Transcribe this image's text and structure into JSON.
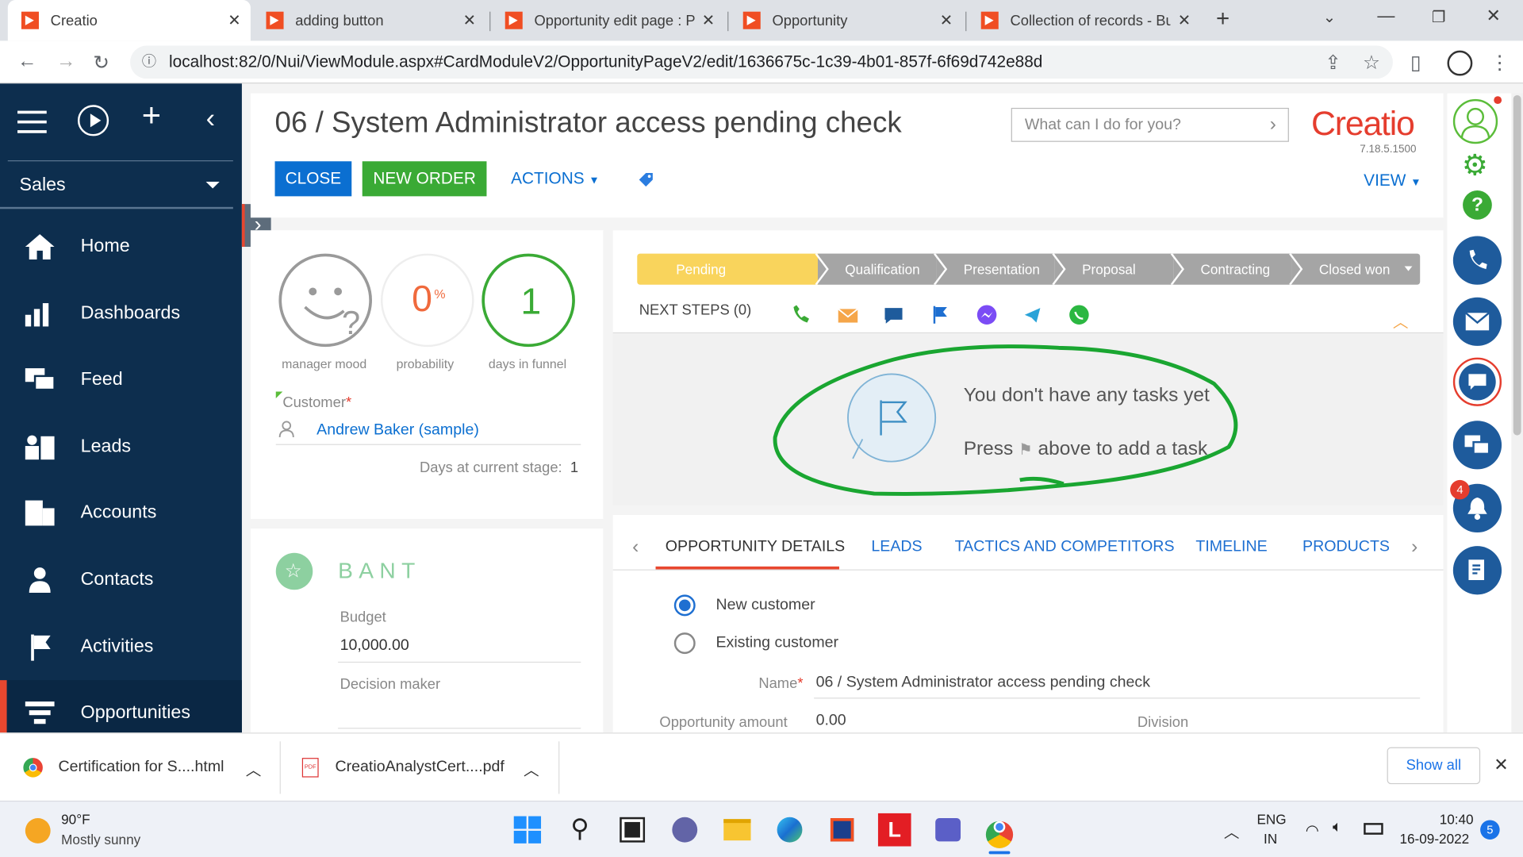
{
  "browser": {
    "tabs": [
      {
        "title": "Creatio",
        "active": true
      },
      {
        "title": "adding button"
      },
      {
        "title": "Opportunity edit page : P"
      },
      {
        "title": "Opportunity"
      },
      {
        "title": "Collection of records - Bu"
      }
    ],
    "url": "localhost:82/0/Nui/ViewModule.aspx#CardModuleV2/OpportunityPageV2/edit/1636675c-1c39-4b01-857f-6f69d742e88d"
  },
  "sidebar": {
    "workplace": "Sales",
    "items": [
      {
        "label": "Home",
        "icon": "home-icon"
      },
      {
        "label": "Dashboards",
        "icon": "dashboards-icon"
      },
      {
        "label": "Feed",
        "icon": "feed-icon"
      },
      {
        "label": "Leads",
        "icon": "leads-icon"
      },
      {
        "label": "Accounts",
        "icon": "accounts-icon"
      },
      {
        "label": "Contacts",
        "icon": "contacts-icon"
      },
      {
        "label": "Activities",
        "icon": "activities-icon"
      },
      {
        "label": "Opportunities",
        "icon": "opportunities-icon",
        "active": true
      }
    ]
  },
  "header": {
    "title": "06 / System Administrator access pending check",
    "close": "CLOSE",
    "new_order": "NEW ORDER",
    "actions": "ACTIONS",
    "search_placeholder": "What can I do for you?",
    "brand": "Creatio",
    "version": "7.18.5.1500",
    "view": "VIEW"
  },
  "profile": {
    "manager_mood_label": "manager mood",
    "probability_value": "0",
    "probability_unit": "%",
    "probability_label": "probability",
    "days_value": "1",
    "days_label": "days in funnel",
    "customer_label": "Customer",
    "customer_value": "Andrew Baker (sample)",
    "days_stage_label": "Days at current stage:",
    "days_stage_value": "1"
  },
  "bant": {
    "title": "BANT",
    "budget_label": "Budget",
    "budget_value": "10,000.00",
    "decision_label": "Decision maker"
  },
  "stages": [
    "Pending",
    "Qualification",
    "Presentation",
    "Proposal",
    "Contracting",
    "Closed won"
  ],
  "next_steps": {
    "label": "NEXT STEPS (0)",
    "empty1": "You don't have any tasks yet",
    "empty2a": "Press",
    "empty2b": "above to add a task"
  },
  "detail_tabs": [
    "OPPORTUNITY DETAILS",
    "LEADS",
    "TACTICS AND COMPETITORS",
    "TIMELINE",
    "PRODUCTS"
  ],
  "details": {
    "new_customer": "New customer",
    "existing_customer": "Existing customer",
    "name_label": "Name",
    "name_value": "06 / System Administrator access pending check",
    "amount_label": "Opportunity amount",
    "amount_value": "0.00",
    "division_label": "Division"
  },
  "right_bar": {
    "notif_count": "4"
  },
  "downloads": {
    "file1": "Certification for S....html",
    "file2": "CreatioAnalystCert....pdf",
    "show_all": "Show all"
  },
  "taskbar": {
    "temp": "90°F",
    "weather": "Mostly sunny",
    "lang1": "ENG",
    "lang2": "IN",
    "time": "10:40",
    "date": "16-09-2022",
    "badge": "5"
  },
  "colors": {
    "sidebar": "#0d2e4e",
    "close_btn": "#0b6fd1",
    "new_order_btn": "#3aaa35",
    "stage_active": "#f9d45c",
    "stage": "#a5a5a5",
    "accent_red": "#e53d2e",
    "annot_green": "#1aa631"
  }
}
